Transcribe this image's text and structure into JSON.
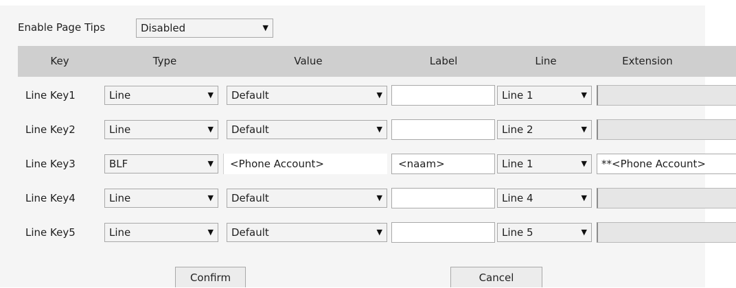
{
  "tips": {
    "label": "Enable Page Tips",
    "value": "Disabled"
  },
  "columns": {
    "key": "Key",
    "type": "Type",
    "value": "Value",
    "label": "Label",
    "line": "Line",
    "extension": "Extension"
  },
  "rows": [
    {
      "key": "Line Key1",
      "type": "Line",
      "value": "Default",
      "label": "",
      "line": "Line 1",
      "extension": ""
    },
    {
      "key": "Line Key2",
      "type": "Line",
      "value": "Default",
      "label": "",
      "line": "Line 2",
      "extension": ""
    },
    {
      "key": "Line Key3",
      "type": "BLF",
      "value": "<Phone Account>",
      "label": "<naam>",
      "line": "Line 1",
      "extension": "**<Phone Account>"
    },
    {
      "key": "Line Key4",
      "type": "Line",
      "value": "Default",
      "label": "",
      "line": "Line 4",
      "extension": ""
    },
    {
      "key": "Line Key5",
      "type": "Line",
      "value": "Default",
      "label": "",
      "line": "Line 5",
      "extension": ""
    }
  ],
  "buttons": {
    "confirm": "Confirm",
    "cancel": "Cancel"
  },
  "icons": {
    "dropdown_arrow": "▼"
  }
}
